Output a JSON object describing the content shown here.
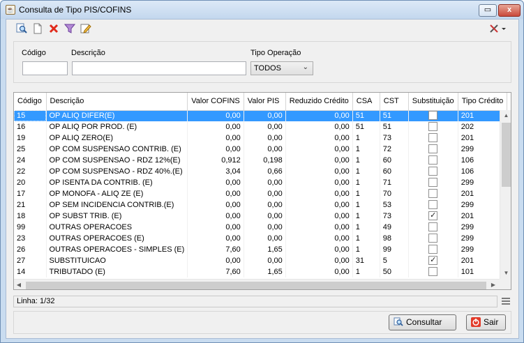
{
  "window": {
    "title": "Consulta de Tipo PIS/COFINS",
    "title_icon": "java-cup-icon",
    "close_glyph": "x",
    "minimize_glyph": "▭"
  },
  "toolbar": {
    "icons": [
      "search-document-icon",
      "new-document-icon",
      "delete-x-icon",
      "filter-funnel-icon",
      "edit-pencil-icon"
    ],
    "tools_icon": "tools-icon"
  },
  "filters": {
    "codigo_label": "Código",
    "codigo_value": "",
    "descricao_label": "Descrição",
    "descricao_value": "",
    "tipo_operacao_label": "Tipo Operação",
    "tipo_operacao_value": "TODOS"
  },
  "grid": {
    "columns": [
      "Código",
      "Descrição",
      "Valor COFINS",
      "Valor PIS",
      "Reduzido Crédito",
      "CSA",
      "CST",
      "Substituição",
      "Tipo Crédito"
    ],
    "rows": [
      {
        "codigo": "15",
        "descricao": "OP ALIQ DIFER(E)",
        "cofins": "0,00",
        "pis": "0,00",
        "reduzido": "0,00",
        "csa": "51",
        "cst": "51",
        "subst": false,
        "tipo": "201",
        "selected": true
      },
      {
        "codigo": "16",
        "descricao": "OP ALIQ POR PROD. (E)",
        "cofins": "0,00",
        "pis": "0,00",
        "reduzido": "0,00",
        "csa": "51",
        "cst": "51",
        "subst": false,
        "tipo": "202",
        "selected": false
      },
      {
        "codigo": "19",
        "descricao": "OP ALIQ ZERO(E)",
        "cofins": "0,00",
        "pis": "0,00",
        "reduzido": "0,00",
        "csa": "1",
        "cst": "73",
        "subst": false,
        "tipo": "201",
        "selected": false
      },
      {
        "codigo": "25",
        "descricao": "OP COM SUSPENSAO CONTRIB. (E)",
        "cofins": "0,00",
        "pis": "0,00",
        "reduzido": "0,00",
        "csa": "1",
        "cst": "72",
        "subst": false,
        "tipo": "299",
        "selected": false
      },
      {
        "codigo": "24",
        "descricao": "OP COM SUSPENSAO - RDZ 12%(E)",
        "cofins": "0,912",
        "pis": "0,198",
        "reduzido": "0,00",
        "csa": "1",
        "cst": "60",
        "subst": false,
        "tipo": "106",
        "selected": false
      },
      {
        "codigo": "22",
        "descricao": "OP COM SUSPENSAO - RDZ 40%.(E)",
        "cofins": "3,04",
        "pis": "0,66",
        "reduzido": "0,00",
        "csa": "1",
        "cst": "60",
        "subst": false,
        "tipo": "106",
        "selected": false
      },
      {
        "codigo": "20",
        "descricao": "OP ISENTA DA CONTRIB. (E)",
        "cofins": "0,00",
        "pis": "0,00",
        "reduzido": "0,00",
        "csa": "1",
        "cst": "71",
        "subst": false,
        "tipo": "299",
        "selected": false
      },
      {
        "codigo": "17",
        "descricao": "OP MONOFA - ALIQ ZE (E)",
        "cofins": "0,00",
        "pis": "0,00",
        "reduzido": "0,00",
        "csa": "1",
        "cst": "70",
        "subst": false,
        "tipo": "201",
        "selected": false
      },
      {
        "codigo": "21",
        "descricao": "OP SEM INCIDENCIA CONTRIB.(E)",
        "cofins": "0,00",
        "pis": "0,00",
        "reduzido": "0,00",
        "csa": "1",
        "cst": "53",
        "subst": false,
        "tipo": "299",
        "selected": false
      },
      {
        "codigo": "18",
        "descricao": "OP SUBST TRIB. (E)",
        "cofins": "0,00",
        "pis": "0,00",
        "reduzido": "0,00",
        "csa": "1",
        "cst": "73",
        "subst": true,
        "tipo": "201",
        "selected": false
      },
      {
        "codigo": "99",
        "descricao": "OUTRAS OPERACOES",
        "cofins": "0,00",
        "pis": "0,00",
        "reduzido": "0,00",
        "csa": "1",
        "cst": "49",
        "subst": false,
        "tipo": "299",
        "selected": false
      },
      {
        "codigo": "23",
        "descricao": "OUTRAS OPERACOES (E)",
        "cofins": "0,00",
        "pis": "0,00",
        "reduzido": "0,00",
        "csa": "1",
        "cst": "98",
        "subst": false,
        "tipo": "299",
        "selected": false
      },
      {
        "codigo": "26",
        "descricao": "OUTRAS OPERACOES - SIMPLES (E)",
        "cofins": "7,60",
        "pis": "1,65",
        "reduzido": "0,00",
        "csa": "1",
        "cst": "99",
        "subst": false,
        "tipo": "299",
        "selected": false
      },
      {
        "codigo": "27",
        "descricao": "SUBSTITUICAO",
        "cofins": "0,00",
        "pis": "0,00",
        "reduzido": "0,00",
        "csa": "31",
        "cst": "5",
        "subst": true,
        "tipo": "201",
        "selected": false
      },
      {
        "codigo": "14",
        "descricao": "TRIBUTADO (E)",
        "cofins": "7,60",
        "pis": "1,65",
        "reduzido": "0,00",
        "csa": "1",
        "cst": "50",
        "subst": false,
        "tipo": "101",
        "selected": false
      }
    ]
  },
  "status": {
    "linha": "Linha: 1/32"
  },
  "buttons": {
    "consultar": "Consultar",
    "sair": "Sair"
  },
  "colors": {
    "selection": "#3399ff",
    "window_frame": "#c9dcf0"
  }
}
